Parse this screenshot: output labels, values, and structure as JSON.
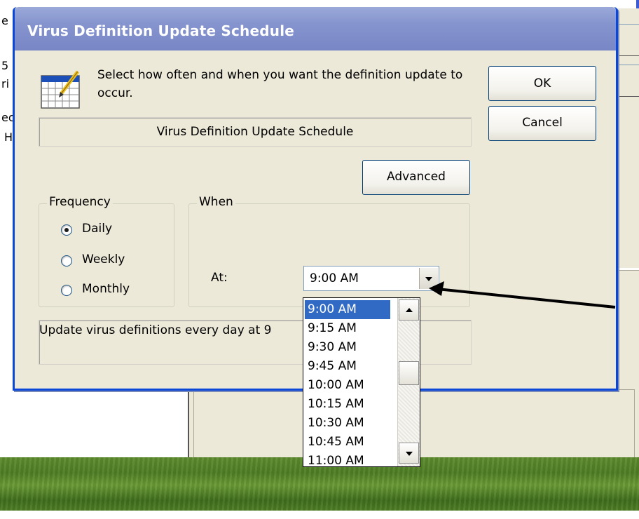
{
  "background_window": {
    "edge_text": [
      "e",
      "5",
      "ri",
      "ec",
      "H"
    ]
  },
  "dialog": {
    "title": "Virus Definition Update Schedule",
    "instruction": "Select how often and when you want the definition update to occur.",
    "summary_box": "Virus Definition Update Schedule",
    "ok_label": "OK",
    "cancel_label": "Cancel",
    "advanced_label": "Advanced",
    "frequency": {
      "label": "Frequency",
      "options": [
        {
          "label": "Daily",
          "checked": true
        },
        {
          "label": "Weekly",
          "checked": false
        },
        {
          "label": "Monthly",
          "checked": false
        }
      ]
    },
    "when": {
      "label": "When",
      "at_label": "At:",
      "selected_value": "9:00 AM"
    },
    "description": "Update virus definitions every day at 9",
    "dropdown_list": {
      "options": [
        "9:00 AM",
        "9:15 AM",
        "9:30 AM",
        "9:45 AM",
        "10:00 AM",
        "10:15 AM",
        "10:30 AM",
        "10:45 AM",
        "11:00 AM"
      ],
      "highlighted": "9:00 AM"
    }
  },
  "annotation": {
    "arrow_color": "#000000"
  },
  "colors": {
    "title_bar": "#8593ce",
    "dialog_face": "#ece9d8",
    "selection": "#316ac5"
  }
}
